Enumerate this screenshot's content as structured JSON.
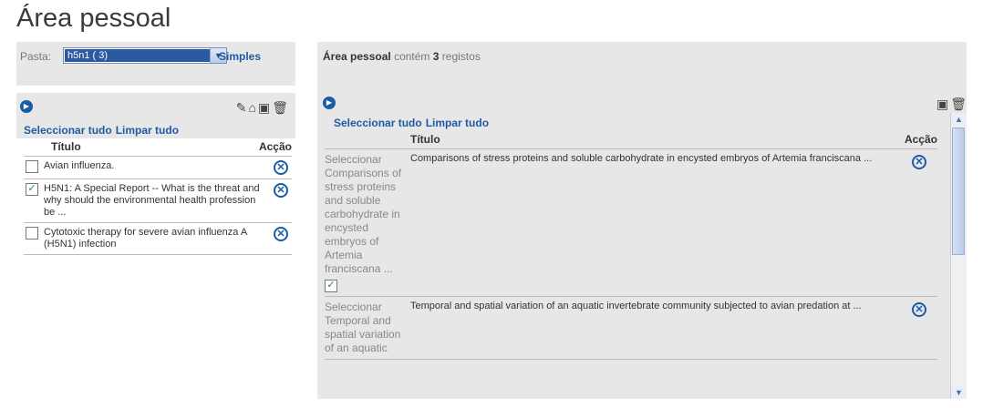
{
  "page_title": "Área pessoal",
  "left": {
    "pasta_label": "Pasta:",
    "folder_selected": "h5n1 ( 3)",
    "simples_link": "Simples",
    "select_all": "Seleccionar tudo",
    "clear_all": "Limpar tudo",
    "col_title": "Título",
    "col_action": "Acção",
    "rows": [
      {
        "title": "Avian influenza.",
        "checked": false
      },
      {
        "title": "H5N1: A Special Report -- What is the threat and why should the environmental health profession be ...",
        "checked": true
      },
      {
        "title": "Cytotoxic therapy for severe avian influenza A (H5N1) infection",
        "checked": false
      }
    ]
  },
  "right": {
    "area_label": "Área pessoal",
    "contains_text": "contém",
    "count": "3",
    "records_text": "registos",
    "select_all": "Seleccionar tudo",
    "clear_all": "Limpar tudo",
    "col_title": "Título",
    "col_action": "Acção",
    "rows": [
      {
        "select_label": "Seleccionar Comparisons of stress proteins and soluble carbohydrate in encysted embryos of Artemia franciscana ...",
        "title": "Comparisons of stress proteins and soluble carbohydrate in encysted embryos of Artemia franciscana ...",
        "checked": true
      },
      {
        "select_label": "Seleccionar Temporal and spatial variation of an aquatic",
        "title": "Temporal and spatial variation of an aquatic invertebrate community subjected to avian predation at ...",
        "checked": false
      }
    ]
  },
  "colors": {
    "accent": "#1f5aa6",
    "panel_bg": "#e7e7e7",
    "select_bg": "#2c5aa0"
  }
}
